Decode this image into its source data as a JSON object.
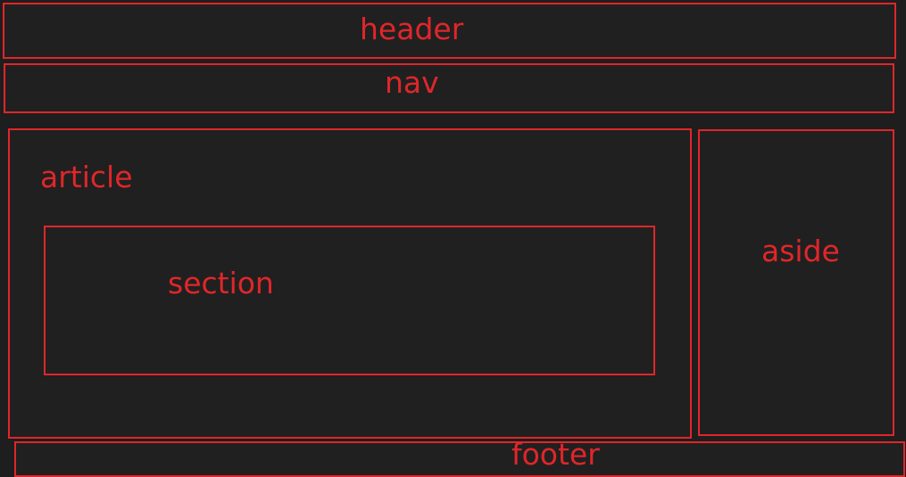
{
  "header": {
    "label": "header"
  },
  "nav": {
    "label": "nav"
  },
  "article": {
    "label": "article",
    "section": {
      "label": "section"
    }
  },
  "aside": {
    "label": "aside"
  },
  "footer": {
    "label": "footer"
  },
  "colors": {
    "background": "#1e1e1e",
    "outline": "#e0262a",
    "text": "#e0262a"
  }
}
